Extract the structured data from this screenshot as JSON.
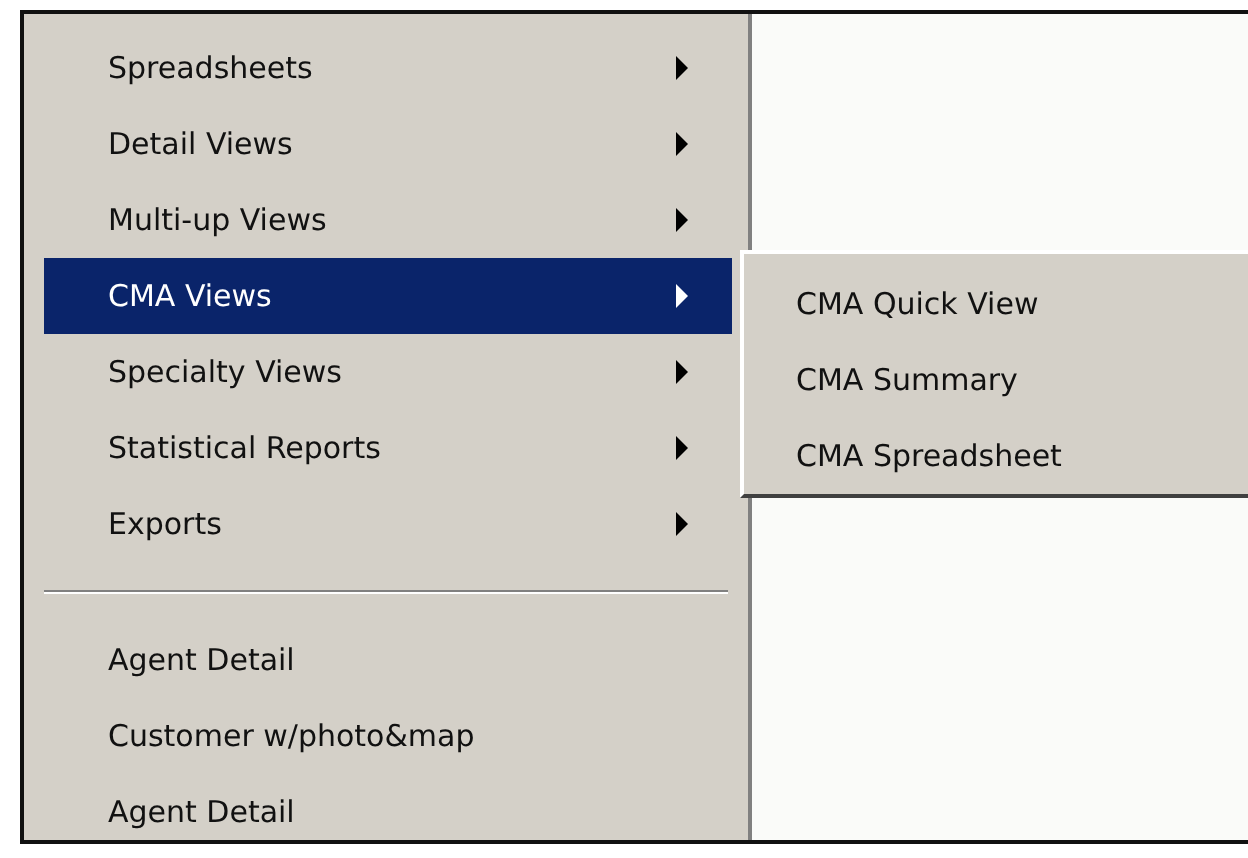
{
  "menu": {
    "sections": [
      [
        {
          "label": "Spreadsheets",
          "kind": "submenu",
          "selected": false
        },
        {
          "label": "Detail Views",
          "kind": "submenu",
          "selected": false
        },
        {
          "label": "Multi-up Views",
          "kind": "submenu",
          "selected": false
        },
        {
          "label": "CMA Views",
          "kind": "submenu",
          "selected": true
        },
        {
          "label": "Specialty Views",
          "kind": "submenu",
          "selected": false
        },
        {
          "label": "Statistical Reports",
          "kind": "submenu",
          "selected": false
        },
        {
          "label": "Exports",
          "kind": "submenu",
          "selected": false
        }
      ],
      [
        {
          "label": "Agent Detail",
          "kind": "command",
          "selected": false
        },
        {
          "label": "Customer w/photo&map",
          "kind": "command",
          "selected": false
        },
        {
          "label": "Agent Detail",
          "kind": "command",
          "selected": false
        }
      ]
    ]
  },
  "submenu": {
    "items": [
      {
        "label": "CMA Quick View",
        "selected": false
      },
      {
        "label": "CMA Summary",
        "selected": false
      },
      {
        "label": "CMA Spreadsheet",
        "selected": false
      }
    ]
  }
}
